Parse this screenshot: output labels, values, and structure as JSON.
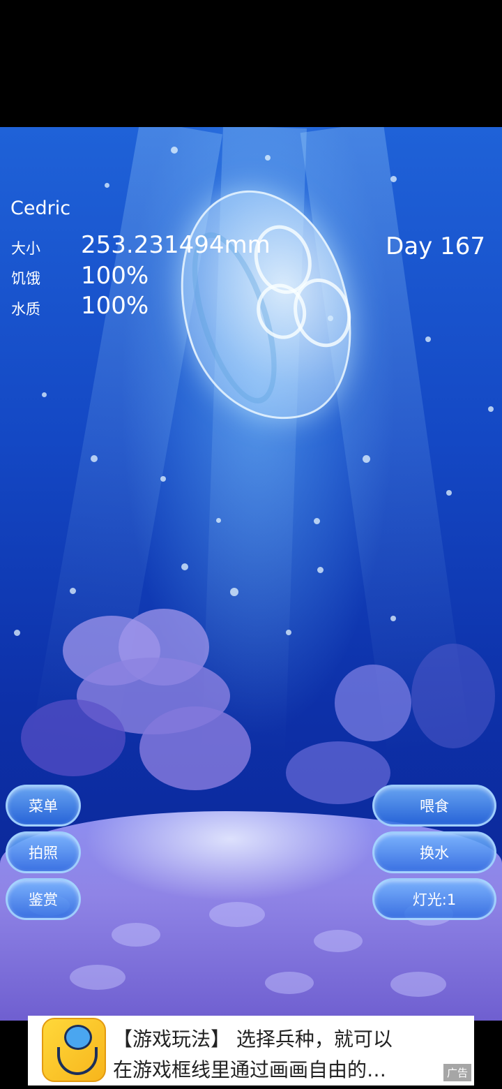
{
  "jelly": {
    "name": "Cedric",
    "stats": [
      {
        "label": "大小",
        "value": "253.231494mm"
      },
      {
        "label": "饥饿",
        "value": "100%"
      },
      {
        "label": "水质",
        "value": "100%"
      }
    ],
    "day": "Day 167"
  },
  "left_buttons": [
    {
      "label": "菜单"
    },
    {
      "label": "拍照"
    },
    {
      "label": "鉴赏"
    }
  ],
  "right_buttons": [
    {
      "label": "喂食"
    },
    {
      "label": "换水"
    },
    {
      "label": "灯光:1"
    }
  ],
  "ad": {
    "line1": "【游戏玩法】 选择兵种，就可以",
    "line2": "在游戏框线里通过画画自由的…",
    "tag": "广告"
  }
}
